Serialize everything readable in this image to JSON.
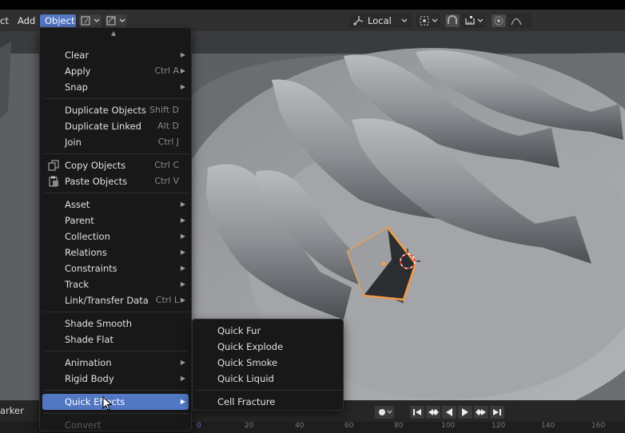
{
  "header": {
    "left_menus": [
      "ct",
      "Add"
    ],
    "active_menu": "Object",
    "orientation_label": "Local"
  },
  "object_menu": {
    "scroll_up": "▲",
    "items": [
      {
        "label": "Clear",
        "shortcut": "",
        "submenu": true
      },
      {
        "label": "Apply",
        "shortcut": "Ctrl A",
        "submenu": true
      },
      {
        "label": "Snap",
        "shortcut": "",
        "submenu": true
      },
      {
        "label": "Duplicate Objects",
        "shortcut": "Shift D",
        "submenu": false
      },
      {
        "label": "Duplicate Linked",
        "shortcut": "Alt D",
        "submenu": false
      },
      {
        "label": "Join",
        "shortcut": "Ctrl J",
        "submenu": false
      },
      {
        "label": "Copy Objects",
        "shortcut": "Ctrl C",
        "submenu": false
      },
      {
        "label": "Paste Objects",
        "shortcut": "Ctrl V",
        "submenu": false
      },
      {
        "label": "Asset",
        "shortcut": "",
        "submenu": true
      },
      {
        "label": "Parent",
        "shortcut": "",
        "submenu": true
      },
      {
        "label": "Collection",
        "shortcut": "",
        "submenu": true
      },
      {
        "label": "Relations",
        "shortcut": "",
        "submenu": true
      },
      {
        "label": "Constraints",
        "shortcut": "",
        "submenu": true
      },
      {
        "label": "Track",
        "shortcut": "",
        "submenu": true
      },
      {
        "label": "Link/Transfer Data",
        "shortcut": "Ctrl L",
        "submenu": true
      },
      {
        "label": "Shade Smooth",
        "shortcut": "",
        "submenu": false
      },
      {
        "label": "Shade Flat",
        "shortcut": "",
        "submenu": false
      },
      {
        "label": "Animation",
        "shortcut": "",
        "submenu": true
      },
      {
        "label": "Rigid Body",
        "shortcut": "",
        "submenu": true
      },
      {
        "label": "Quick Effects",
        "shortcut": "",
        "submenu": true
      },
      {
        "label": "Convert",
        "shortcut": "",
        "submenu": true
      }
    ]
  },
  "quick_effects_menu": {
    "items": [
      "Quick Fur",
      "Quick Explode",
      "Quick Smoke",
      "Quick Liquid",
      "Cell Fracture"
    ]
  },
  "timeline": {
    "marker_label": "arker",
    "ruler_ticks": [
      "0",
      "20",
      "40",
      "60",
      "80",
      "100",
      "120",
      "140",
      "160"
    ]
  },
  "colors": {
    "accent": "#5277c3",
    "menu_bg": "#181818",
    "selection_outline": "#f39c4a"
  }
}
